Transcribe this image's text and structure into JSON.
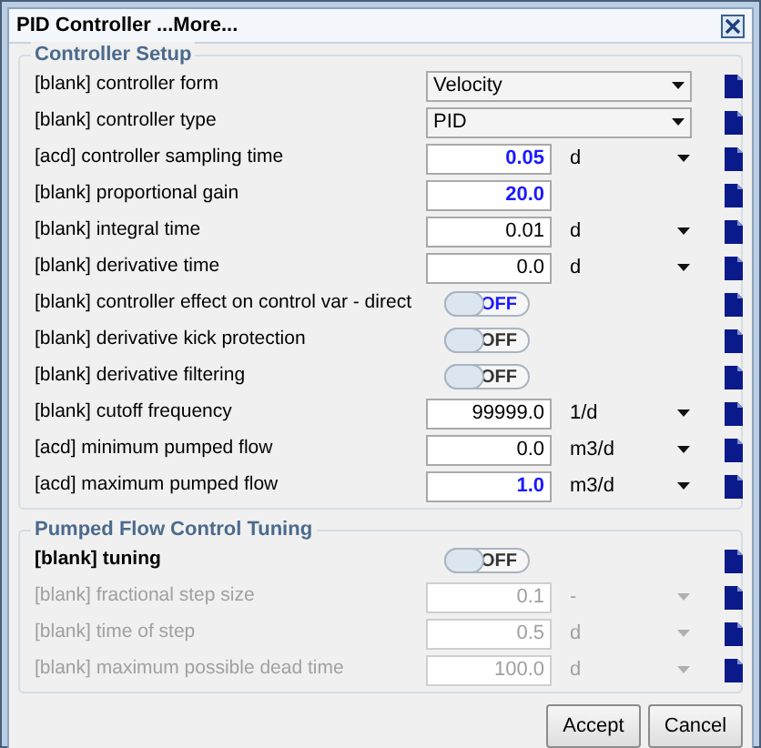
{
  "window": {
    "title": "PID Controller ...More..."
  },
  "groups": [
    {
      "title": "Controller Setup",
      "rows": [
        {
          "kind": "dropdown",
          "label": "[blank] controller form",
          "value": "Velocity",
          "modified": false,
          "disabled": false
        },
        {
          "kind": "dropdown",
          "label": "[blank] controller type",
          "value": "PID",
          "modified": false,
          "disabled": false
        },
        {
          "kind": "number",
          "label": "[acd] controller sampling time",
          "value": "0.05",
          "unit": "d",
          "modified": true,
          "disabled": false
        },
        {
          "kind": "number",
          "label": "[blank] proportional gain",
          "value": "20.0",
          "modified": true,
          "disabled": false
        },
        {
          "kind": "number",
          "label": "[blank] integral time",
          "value": "0.01",
          "unit": "d",
          "modified": false,
          "disabled": false
        },
        {
          "kind": "number",
          "label": "[blank] derivative time",
          "value": "0.0",
          "unit": "d",
          "modified": false,
          "disabled": false
        },
        {
          "kind": "toggle",
          "label": "[blank] controller effect on control var - direct",
          "value": "OFF",
          "on": false,
          "modified": true,
          "disabled": false
        },
        {
          "kind": "toggle",
          "label": "[blank] derivative kick protection",
          "value": "OFF",
          "on": false,
          "modified": false,
          "disabled": false
        },
        {
          "kind": "toggle",
          "label": "[blank] derivative filtering",
          "value": "OFF",
          "on": false,
          "modified": false,
          "disabled": false
        },
        {
          "kind": "number",
          "label": "[blank] cutoff frequency",
          "value": "99999.0",
          "unit": "1/d",
          "modified": false,
          "disabled": false
        },
        {
          "kind": "number",
          "label": "[acd] minimum pumped flow",
          "value": "0.0",
          "unit": "m3/d",
          "modified": false,
          "disabled": false
        },
        {
          "kind": "number",
          "label": "[acd] maximum pumped flow",
          "value": "1.0",
          "unit": "m3/d",
          "modified": true,
          "disabled": false
        }
      ]
    },
    {
      "title": "Pumped Flow Control Tuning",
      "rows": [
        {
          "kind": "toggle",
          "label": "[blank] tuning",
          "value": "OFF",
          "on": false,
          "modified": false,
          "disabled": false,
          "bold": true
        },
        {
          "kind": "number",
          "label": "[blank] fractional step size",
          "value": "0.1",
          "unit": "-",
          "disabled": true
        },
        {
          "kind": "number",
          "label": "[blank] time of step",
          "value": "0.5",
          "unit": "d",
          "disabled": true
        },
        {
          "kind": "number",
          "label": "[blank] maximum possible dead time",
          "value": "100.0",
          "unit": "d",
          "disabled": true
        }
      ]
    }
  ],
  "buttons": [
    "Accept",
    "Cancel"
  ]
}
